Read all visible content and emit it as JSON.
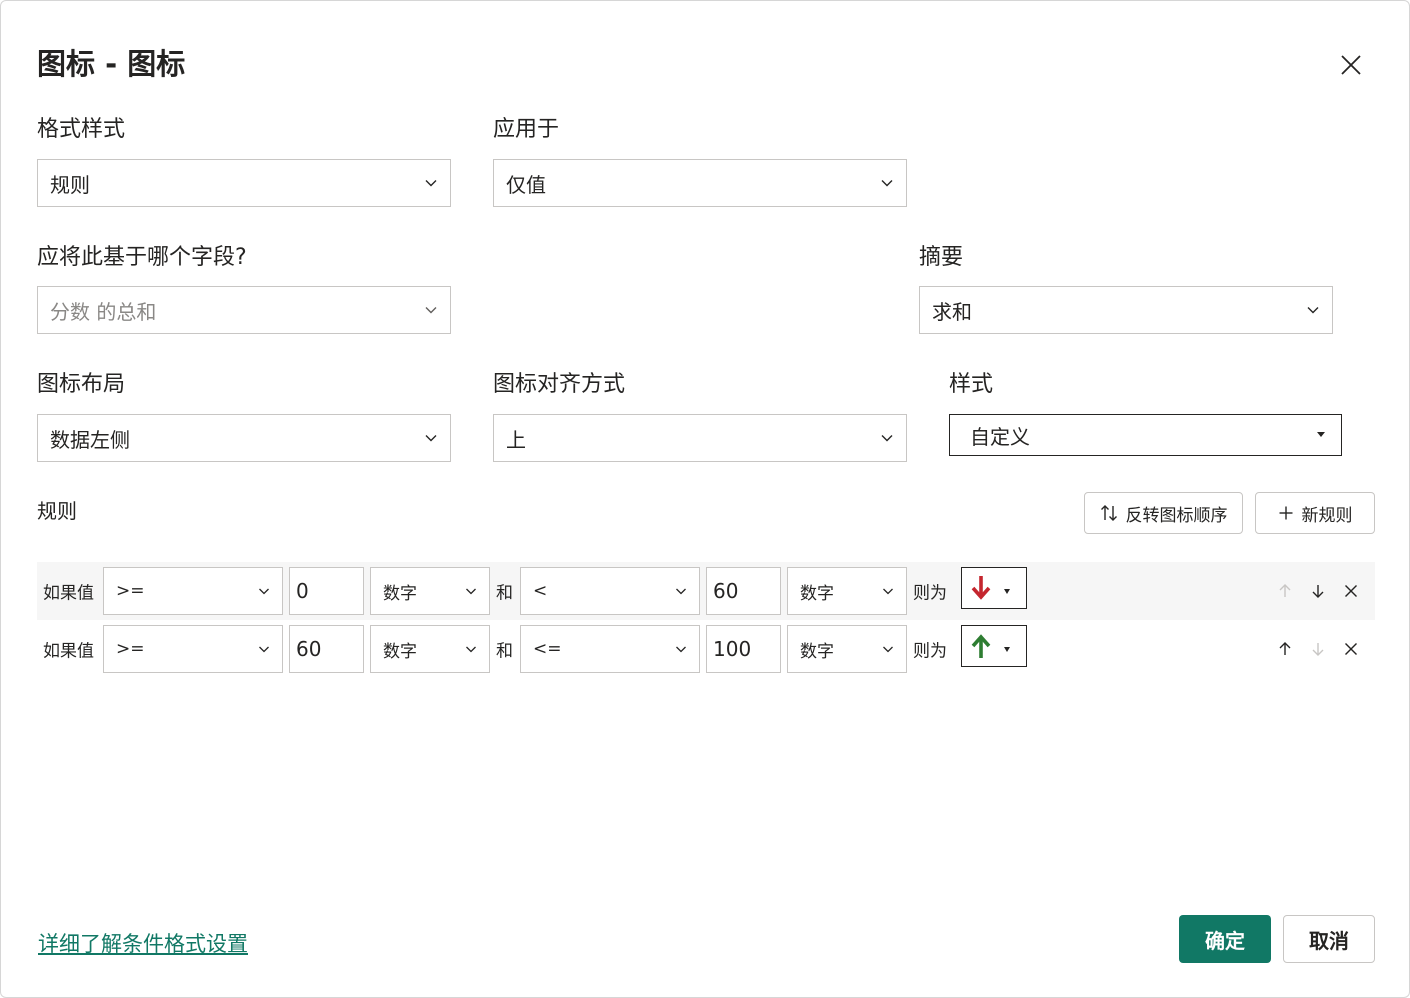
{
  "dialog": {
    "title": "图标 - 图标",
    "close_icon": "close-icon"
  },
  "fields": {
    "format_style": {
      "label": "格式样式",
      "value": "规则"
    },
    "apply_to": {
      "label": "应用于",
      "value": "仅值"
    },
    "base_field": {
      "label": "应将此基于哪个字段?",
      "value": "分数 的总和"
    },
    "summary": {
      "label": "摘要",
      "value": "求和"
    },
    "icon_layout": {
      "label": "图标布局",
      "value": "数据左侧"
    },
    "icon_alignment": {
      "label": "图标对齐方式",
      "value": "上"
    },
    "style": {
      "label": "样式",
      "value": "自定义"
    }
  },
  "rules": {
    "label": "规则",
    "reverse_button": "反转图标顺序",
    "new_rule_button": "新规则",
    "rows": [
      {
        "if_label": "如果值",
        "op1": ">=",
        "val1": "0",
        "type1": "数字",
        "and_label": "和",
        "op2": "<",
        "val2": "60",
        "type2": "数字",
        "then_label": "则为",
        "icon": "arrow-down-red-icon",
        "icon_color": "#c4262e",
        "move_up_enabled": false,
        "move_down_enabled": true
      },
      {
        "if_label": "如果值",
        "op1": ">=",
        "val1": "60",
        "type1": "数字",
        "and_label": "和",
        "op2": "<=",
        "val2": "100",
        "type2": "数字",
        "then_label": "则为",
        "icon": "arrow-up-green-icon",
        "icon_color": "#2e7d32",
        "move_up_enabled": true,
        "move_down_enabled": false
      }
    ]
  },
  "footer": {
    "learn_more_link": "详细了解条件格式设置",
    "ok_button": "确定",
    "cancel_button": "取消"
  },
  "colors": {
    "primary": "#117865",
    "border": "#c8c6c4",
    "text": "#252423",
    "disabled_text": "#8a8886",
    "row_shade": "#f6f6f6"
  }
}
